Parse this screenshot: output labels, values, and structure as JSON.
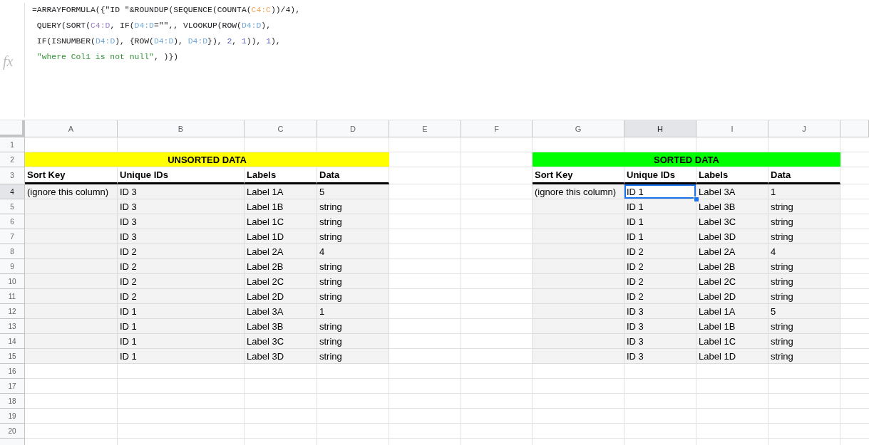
{
  "formula_bar": {
    "fx": "fx",
    "lines": [
      [
        {
          "kind": "plain",
          "text": "=ARRAYFORMULA({\"ID \"&ROUNDUP(SEQUENCE(COUNTA("
        },
        {
          "kind": "range",
          "text": "C4:C",
          "color": "#f1a45a"
        },
        {
          "kind": "plain",
          "text": "))/4),"
        }
      ],
      [
        {
          "kind": "plain",
          "text": " QUERY(SORT("
        },
        {
          "kind": "range",
          "text": "C4:D",
          "color": "#9a7fc9"
        },
        {
          "kind": "plain",
          "text": ", IF("
        },
        {
          "kind": "range",
          "text": "D4:D",
          "color": "#74a9d8"
        },
        {
          "kind": "plain",
          "text": "=\"\",, VLOOKUP(ROW("
        },
        {
          "kind": "range",
          "text": "D4:D",
          "color": "#74a9d8"
        },
        {
          "kind": "plain",
          "text": "),"
        }
      ],
      [
        {
          "kind": "plain",
          "text": " IF(ISNUMBER("
        },
        {
          "kind": "range",
          "text": "D4:D",
          "color": "#74a9d8"
        },
        {
          "kind": "plain",
          "text": "), {ROW("
        },
        {
          "kind": "range",
          "text": "D4:D",
          "color": "#74a9d8"
        },
        {
          "kind": "plain",
          "text": "), "
        },
        {
          "kind": "range",
          "text": "D4:D",
          "color": "#74a9d8"
        },
        {
          "kind": "plain",
          "text": "}), "
        },
        {
          "kind": "number",
          "text": "2"
        },
        {
          "kind": "plain",
          "text": ", "
        },
        {
          "kind": "number",
          "text": "1"
        },
        {
          "kind": "plain",
          "text": ")), "
        },
        {
          "kind": "number",
          "text": "1"
        },
        {
          "kind": "plain",
          "text": "),"
        }
      ],
      [
        {
          "kind": "string",
          "text": " \"where Col1 is not null\""
        },
        {
          "kind": "plain",
          "text": ", )})"
        }
      ]
    ]
  },
  "sheet": {
    "columns": [
      {
        "label": "A",
        "selected": false
      },
      {
        "label": "B",
        "selected": false
      },
      {
        "label": "C",
        "selected": false
      },
      {
        "label": "D",
        "selected": false
      },
      {
        "label": "E",
        "selected": false
      },
      {
        "label": "F",
        "selected": false
      },
      {
        "label": "G",
        "selected": false
      },
      {
        "label": "H",
        "selected": true
      },
      {
        "label": "I",
        "selected": false
      },
      {
        "label": "J",
        "selected": false
      }
    ],
    "rows": [
      {
        "label": "1",
        "selected": false
      },
      {
        "label": "2",
        "selected": false
      },
      {
        "label": "3",
        "selected": false
      },
      {
        "label": "4",
        "selected": true
      },
      {
        "label": "5",
        "selected": false
      },
      {
        "label": "6",
        "selected": false
      },
      {
        "label": "7",
        "selected": false
      },
      {
        "label": "8",
        "selected": false
      },
      {
        "label": "9",
        "selected": false
      },
      {
        "label": "10",
        "selected": false
      },
      {
        "label": "11",
        "selected": false
      },
      {
        "label": "12",
        "selected": false
      },
      {
        "label": "13",
        "selected": false
      },
      {
        "label": "14",
        "selected": false
      },
      {
        "label": "15",
        "selected": false
      },
      {
        "label": "16",
        "selected": false
      },
      {
        "label": "17",
        "selected": false
      },
      {
        "label": "18",
        "selected": false
      },
      {
        "label": "19",
        "selected": false
      },
      {
        "label": "20",
        "selected": false
      }
    ],
    "tables": [
      {
        "title": "UNSORTED DATA",
        "color": "#ffff00",
        "headers": [
          "Sort Key",
          "Unique IDs",
          "Labels",
          "Data"
        ],
        "rows": [
          {
            "sort_key": "(ignore this column)",
            "cells": [
              {
                "text": "ID 3",
                "selected": false
              },
              {
                "text": "Label 1A",
                "selected": false
              },
              {
                "text": "5",
                "selected": false
              }
            ]
          },
          {
            "cells": [
              {
                "text": "ID 3",
                "selected": false
              },
              {
                "text": "Label 1B",
                "selected": false
              },
              {
                "text": "string",
                "selected": false
              }
            ]
          },
          {
            "cells": [
              {
                "text": "ID 3",
                "selected": false
              },
              {
                "text": "Label 1C",
                "selected": false
              },
              {
                "text": "string",
                "selected": false
              }
            ]
          },
          {
            "cells": [
              {
                "text": "ID 3",
                "selected": false
              },
              {
                "text": "Label 1D",
                "selected": false
              },
              {
                "text": "string",
                "selected": false
              }
            ]
          },
          {
            "cells": [
              {
                "text": "ID 2",
                "selected": false
              },
              {
                "text": "Label 2A",
                "selected": false
              },
              {
                "text": "4",
                "selected": false
              }
            ]
          },
          {
            "cells": [
              {
                "text": "ID 2",
                "selected": false
              },
              {
                "text": "Label 2B",
                "selected": false
              },
              {
                "text": "string",
                "selected": false
              }
            ]
          },
          {
            "cells": [
              {
                "text": "ID 2",
                "selected": false
              },
              {
                "text": "Label 2C",
                "selected": false
              },
              {
                "text": "string",
                "selected": false
              }
            ]
          },
          {
            "cells": [
              {
                "text": "ID 2",
                "selected": false
              },
              {
                "text": "Label 2D",
                "selected": false
              },
              {
                "text": "string",
                "selected": false
              }
            ]
          },
          {
            "cells": [
              {
                "text": "ID 1",
                "selected": false
              },
              {
                "text": "Label 3A",
                "selected": false
              },
              {
                "text": "1",
                "selected": false
              }
            ]
          },
          {
            "cells": [
              {
                "text": "ID 1",
                "selected": false
              },
              {
                "text": "Label 3B",
                "selected": false
              },
              {
                "text": "string",
                "selected": false
              }
            ]
          },
          {
            "cells": [
              {
                "text": "ID 1",
                "selected": false
              },
              {
                "text": "Label 3C",
                "selected": false
              },
              {
                "text": "string",
                "selected": false
              }
            ]
          },
          {
            "cells": [
              {
                "text": "ID 1",
                "selected": false
              },
              {
                "text": "Label 3D",
                "selected": false
              },
              {
                "text": "string",
                "selected": false
              }
            ]
          }
        ]
      },
      {
        "title": "SORTED DATA",
        "color": "#00ff00",
        "headers": [
          "Sort Key",
          "Unique IDs",
          "Labels",
          "Data"
        ],
        "rows": [
          {
            "sort_key": "(ignore this column)",
            "cells": [
              {
                "text": "ID 1",
                "selected": true
              },
              {
                "text": "Label 3A",
                "selected": false
              },
              {
                "text": "1",
                "selected": false
              }
            ]
          },
          {
            "cells": [
              {
                "text": "ID 1",
                "selected": false
              },
              {
                "text": "Label 3B",
                "selected": false
              },
              {
                "text": "string",
                "selected": false
              }
            ]
          },
          {
            "cells": [
              {
                "text": "ID 1",
                "selected": false
              },
              {
                "text": "Label 3C",
                "selected": false
              },
              {
                "text": "string",
                "selected": false
              }
            ]
          },
          {
            "cells": [
              {
                "text": "ID 1",
                "selected": false
              },
              {
                "text": "Label 3D",
                "selected": false
              },
              {
                "text": "string",
                "selected": false
              }
            ]
          },
          {
            "cells": [
              {
                "text": "ID 2",
                "selected": false
              },
              {
                "text": "Label 2A",
                "selected": false
              },
              {
                "text": "4",
                "selected": false
              }
            ]
          },
          {
            "cells": [
              {
                "text": "ID 2",
                "selected": false
              },
              {
                "text": "Label 2B",
                "selected": false
              },
              {
                "text": "string",
                "selected": false
              }
            ]
          },
          {
            "cells": [
              {
                "text": "ID 2",
                "selected": false
              },
              {
                "text": "Label 2C",
                "selected": false
              },
              {
                "text": "string",
                "selected": false
              }
            ]
          },
          {
            "cells": [
              {
                "text": "ID 2",
                "selected": false
              },
              {
                "text": "Label 2D",
                "selected": false
              },
              {
                "text": "string",
                "selected": false
              }
            ]
          },
          {
            "cells": [
              {
                "text": "ID 3",
                "selected": false
              },
              {
                "text": "Label 1A",
                "selected": false
              },
              {
                "text": "5",
                "selected": false
              }
            ]
          },
          {
            "cells": [
              {
                "text": "ID 3",
                "selected": false
              },
              {
                "text": "Label 1B",
                "selected": false
              },
              {
                "text": "string",
                "selected": false
              }
            ]
          },
          {
            "cells": [
              {
                "text": "ID 3",
                "selected": false
              },
              {
                "text": "Label 1C",
                "selected": false
              },
              {
                "text": "string",
                "selected": false
              }
            ]
          },
          {
            "cells": [
              {
                "text": "ID 3",
                "selected": false
              },
              {
                "text": "Label 1D",
                "selected": false
              },
              {
                "text": "string",
                "selected": false
              }
            ]
          }
        ]
      }
    ]
  }
}
